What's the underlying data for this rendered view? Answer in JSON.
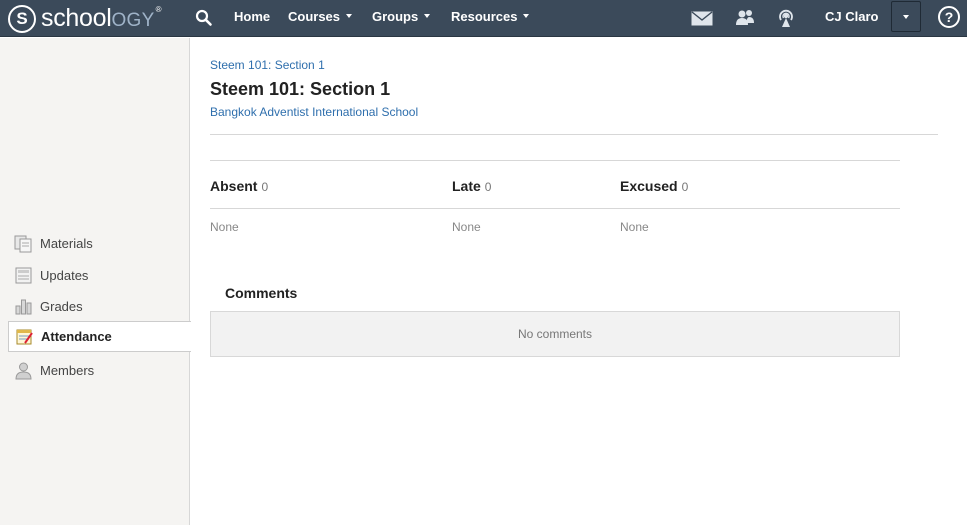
{
  "brand": {
    "name_part1": "school",
    "name_part2": "ogy",
    "mark": "S",
    "tm": "®"
  },
  "nav": {
    "home": "Home",
    "courses": "Courses",
    "groups": "Groups",
    "resources": "Resources"
  },
  "user": {
    "name": "CJ Claro"
  },
  "help": {
    "glyph": "?"
  },
  "sidebar": {
    "items": [
      {
        "label": "Materials",
        "icon": "materials-icon",
        "active": false
      },
      {
        "label": "Updates",
        "icon": "updates-icon",
        "active": false
      },
      {
        "label": "Grades",
        "icon": "grades-icon",
        "active": false
      },
      {
        "label": "Attendance",
        "icon": "attendance-icon",
        "active": true
      },
      {
        "label": "Members",
        "icon": "members-icon",
        "active": false
      }
    ]
  },
  "main": {
    "breadcrumb": "Steem 101: Section 1",
    "title": "Steem 101: Section 1",
    "school": "Bangkok Adventist International School",
    "stats": [
      {
        "label": "Absent",
        "count": "0",
        "value": "None"
      },
      {
        "label": "Late",
        "count": "0",
        "value": "None"
      },
      {
        "label": "Excused",
        "count": "0",
        "value": "None"
      }
    ],
    "comments_title": "Comments",
    "comments_empty": "No comments"
  },
  "colors": {
    "topbar": "#3b4a5a",
    "link": "#2f6fad",
    "sidebar_bg": "#f5f4f2"
  }
}
